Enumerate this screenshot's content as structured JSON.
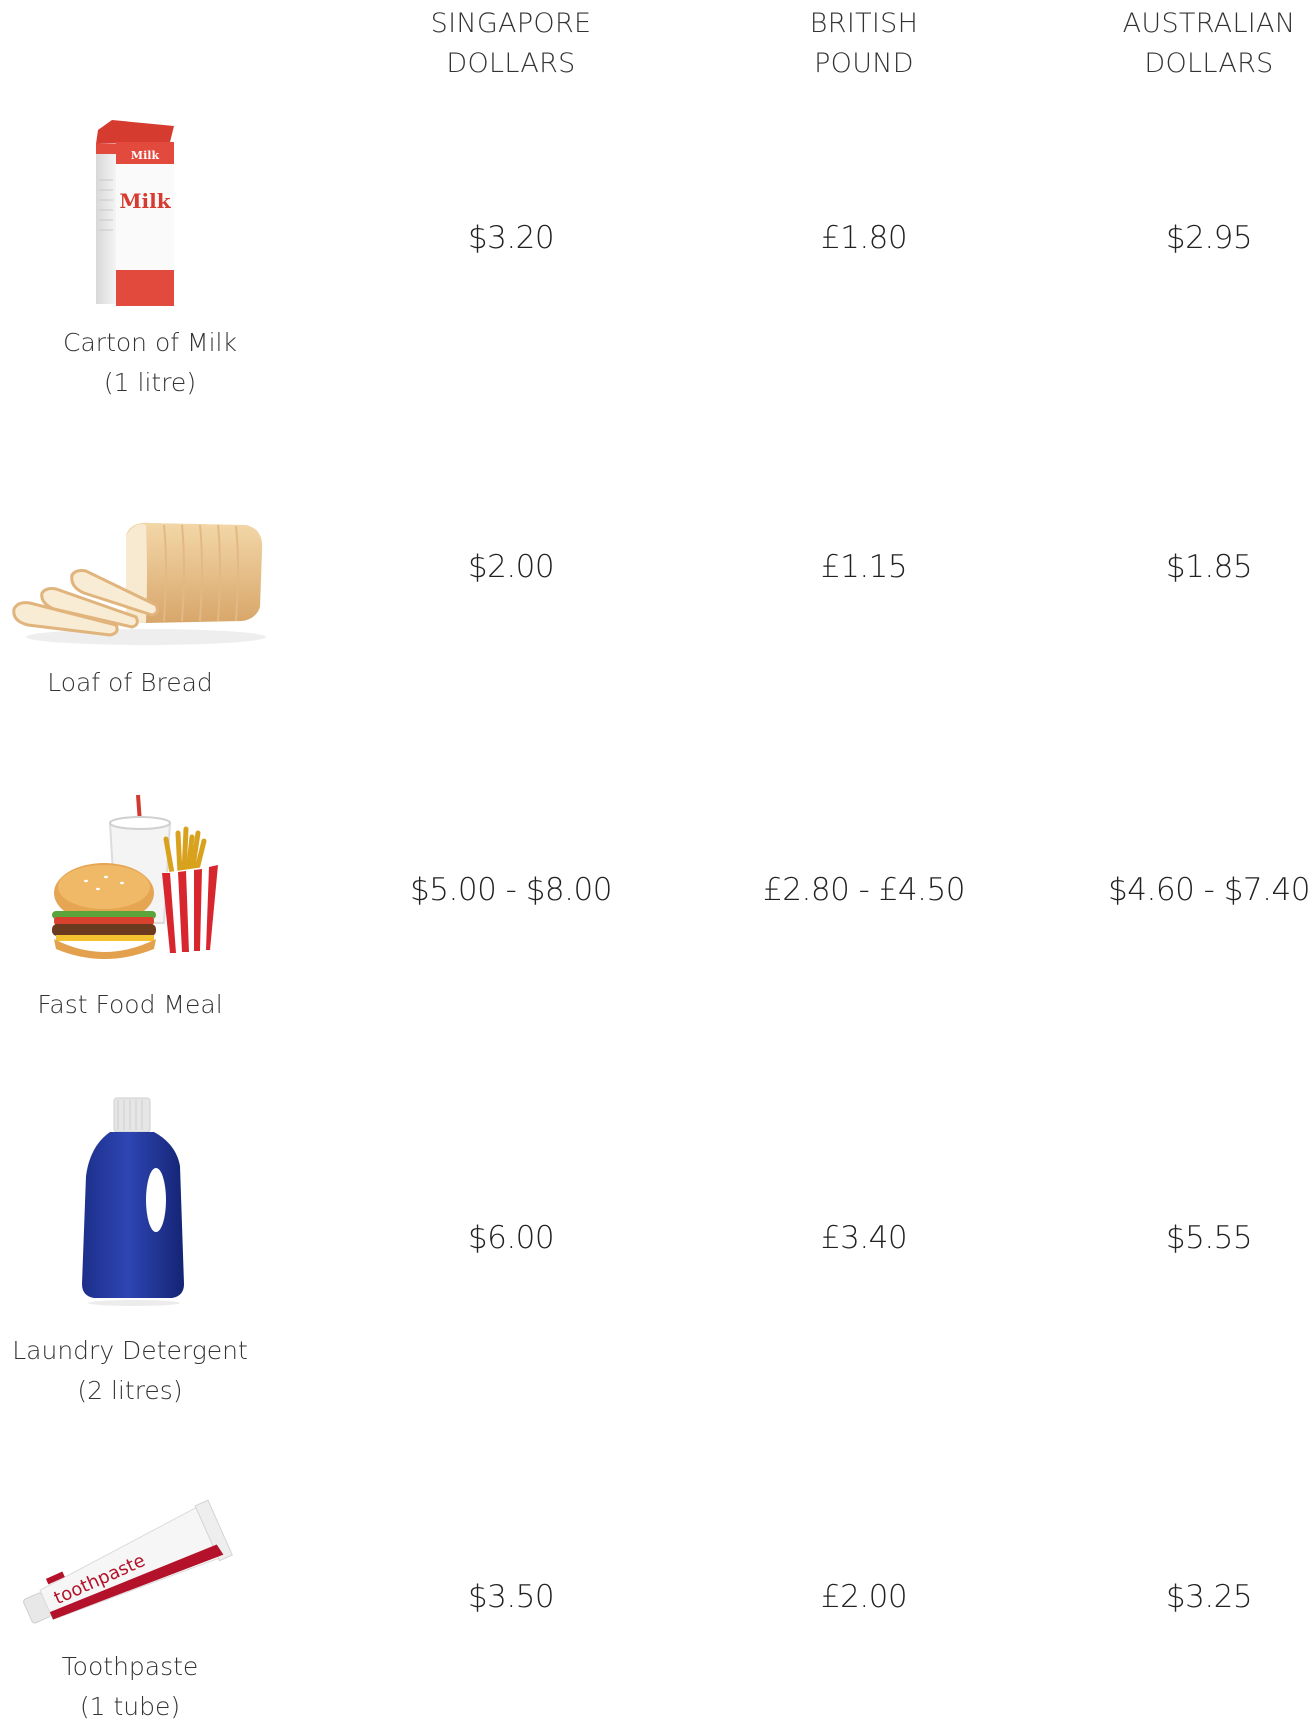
{
  "headers": [
    {
      "line1": "SINGAPORE",
      "line2": "DOLLARS"
    },
    {
      "line1": "BRITISH",
      "line2": "POUND"
    },
    {
      "line1": "AUSTRALIAN",
      "line2": "DOLLARS"
    }
  ],
  "items": [
    {
      "name_line1": "Carton of Milk",
      "name_line2": "(1 litre)",
      "icon": "milk-carton-icon",
      "prices": [
        "$3.20",
        "£1.80",
        "$2.95"
      ],
      "carton_text": "Milk",
      "carton_small_text": "Milk"
    },
    {
      "name_line1": "Loaf of Bread",
      "name_line2": "",
      "icon": "bread-loaf-icon",
      "prices": [
        "$2.00",
        "£1.15",
        "$1.85"
      ]
    },
    {
      "name_line1": "Fast Food Meal",
      "name_line2": "",
      "icon": "fast-food-meal-icon",
      "prices": [
        "$5.00 - $8.00",
        "£2.80 - £4.50",
        "$4.60 - $7.40"
      ]
    },
    {
      "name_line1": "Laundry Detergent",
      "name_line2": "(2 litres)",
      "icon": "detergent-bottle-icon",
      "prices": [
        "$6.00",
        "£3.40",
        "$5.55"
      ]
    },
    {
      "name_line1": "Toothpaste",
      "name_line2": "(1 tube)",
      "icon": "toothpaste-tube-icon",
      "prices": [
        "$3.50",
        "£2.00",
        "$3.25"
      ],
      "tube_text": "toothpaste"
    }
  ]
}
